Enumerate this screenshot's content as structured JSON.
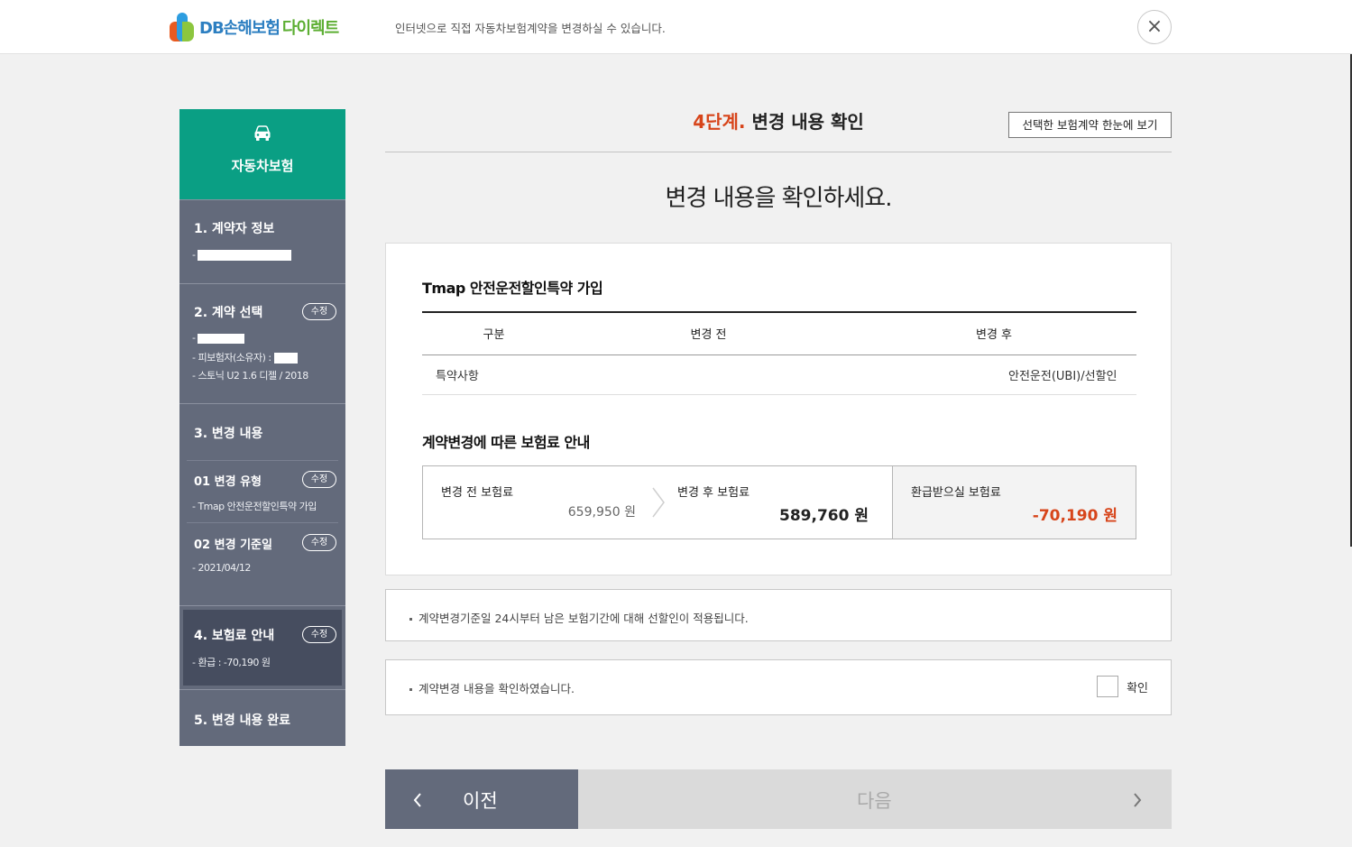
{
  "header": {
    "logo_main": "DB손해보험",
    "logo_sub": "다이렉트",
    "description": "인터넷으로 직접 자동차보험계약을 변경하실 수 있습니다.",
    "close_label": "×"
  },
  "sidebar": {
    "title": "자동차보험",
    "steps": [
      {
        "title": "1. 계약자 정보",
        "lines": [
          "- "
        ]
      },
      {
        "title": "2. 계약 선택",
        "edit": "수정",
        "lines": [
          "- ",
          "- 피보험자(소유자) : ",
          "- 스토닉 U2 1.6 디젤 / 2018"
        ]
      },
      {
        "title": "3. 변경 내용",
        "subs": [
          {
            "title": "01 변경 유형",
            "edit": "수정",
            "line": "- Tmap 안전운전할인특약 가입"
          },
          {
            "title": "02 변경 기준일",
            "edit": "수정",
            "line": "- 2021/04/12"
          }
        ]
      },
      {
        "title": "4. 보험료 안내",
        "edit": "수정",
        "lines": [
          "- 환급 : -70,190 원"
        ]
      },
      {
        "title": "5. 변경 내용 완료"
      }
    ]
  },
  "main": {
    "step_num": "4단계.",
    "step_title": "변경 내용 확인",
    "overview_button": "선택한 보험계약 한눈에 보기",
    "headline": "변경 내용을 확인하세요.",
    "section1_title": "Tmap 안전운전할인특약 가입",
    "table": {
      "headers": [
        "구분",
        "변경 전",
        "변경 후"
      ],
      "rows": [
        [
          "특약사항",
          "",
          "안전운전(UBI)/선할인"
        ]
      ]
    },
    "section2_title": "계약변경에 따른 보험료 안내",
    "premium": {
      "before_label": "변경 전 보험료",
      "before_value": "659,950 원",
      "after_label": "변경 후 보험료",
      "after_value": "589,760 원",
      "refund_label": "환급받으실 보험료",
      "refund_value": "-70,190 원"
    },
    "note": "계약변경기준일 24시부터 남은 보험기간에 대해 선할인이 적용됩니다.",
    "confirm_text": "계약변경 내용을 확인하였습니다.",
    "confirm_check_label": "확인",
    "prev_label": "이전",
    "next_label": "다음",
    "prev_arrow": "‹",
    "next_arrow": "›"
  },
  "colors": {
    "brand_green": "#0a9f84",
    "sidebar_gray": "#636a7b",
    "accent_red": "#d7451b",
    "next_disabled": "#dadada"
  }
}
